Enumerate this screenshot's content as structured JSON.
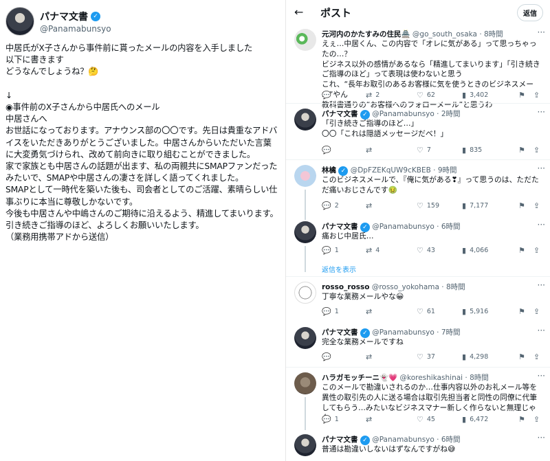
{
  "left": {
    "name": "パナマ文書",
    "handle": "@Panamabunsyo",
    "body": "中居氏がX子さんから事件前に貰ったメールの内容を入手しました\n以下に書きます\nどうなんでしょうね？🤔\n\n↓\n◉事件前のX子さんから中居氏へのメール\n中居さんへ\nお世話になっております。アナウンス部の〇〇です。先日は貴重なアドバイスをいただきありがとうございました。中居さんからいただいた言葉に大変勇気づけられ、改めて前向きに取り組むことができました。\n家で家族とも中居さんの話題が出ます、私の両親共にSMAPファンだったみたいで、SMAPや中居さんの凄さを詳しく語ってくれました。\nSMAPとして一時代を築いた後も、司会者としてのご活躍、素晴らしい仕事ぶりに本当に尊敬しかないです。\n今後も中居さんや中嶋さんのご期待に沿えるよう、精進してまいります。\n引き続きご指導のほど、よろしくお願いいたします。\n（業務用携帯アドから送信）"
  },
  "right": {
    "title": "ポスト",
    "reply_button": "返信",
    "show_replies": "返信を表示",
    "tweets": [
      {
        "name": "元河内のかたすみの住民🏯",
        "handle": "@go_south_osaka · 8時間",
        "text": "えぇ…中居くん、この内容で「オレに気がある」って思っちゃったの…？\nビジネス以外の感情があるなら「精進してまいります」「引き続きご指導のほど」って表現は使わないと思う\nこれ、“長年お取引のあるお客様に気を使うときのビジネスメール”やん\n教科書通りの“お客様へのフォローメール”と思うわ",
        "reply": "",
        "retweet": "2",
        "like": "62",
        "views": "3,402"
      },
      {
        "name": "パナマ文書",
        "handle": "@Panamabunsyo · 2時間",
        "text": "「引き続きご指導のほど…」\n〇〇「これは隠語メッセージだべ！」",
        "reply": "",
        "retweet": "",
        "like": "7",
        "views": "835"
      },
      {
        "name": "林檎",
        "handle": "@DpFZEKqUW9cKBEB · 9時間",
        "text": "このビジネスメールで、『俺に気がある❣』って思うのは、ただただ痛いおじさんです🤢",
        "reply": "2",
        "retweet": "",
        "like": "159",
        "views": "7,177"
      },
      {
        "name": "パナマ文書",
        "handle": "@Panamabunsyo · 6時間",
        "text": "痛おじ中居氏…",
        "reply": "1",
        "retweet": "4",
        "like": "43",
        "views": "4,066"
      },
      {
        "name": "rosso_rosso",
        "handle": "@rosso_yokohama · 8時間",
        "text": "丁寧な業務メールやな😀",
        "reply": "1",
        "retweet": "",
        "like": "61",
        "views": "5,916"
      },
      {
        "name": "パナマ文書",
        "handle": "@Panamabunsyo · 7時間",
        "text": "完全な業務メールですね",
        "reply": "",
        "retweet": "",
        "like": "37",
        "views": "4,298"
      },
      {
        "name": "ハラガモッチーニ👻💗",
        "handle": "@koreshikashinai · 8時間",
        "text": "このメールで勘違いされるのか…仕事内容以外のお礼メール等を異性の取引先の人に送る場合は取引先担当者と同性の同僚に代筆してもらう…みたいなビジネスマナー新しく作らないと無理じゃん",
        "reply": "1",
        "retweet": "",
        "like": "45",
        "views": "6,472"
      },
      {
        "name": "パナマ文書",
        "handle": "@Panamabunsyo · 6時間",
        "text": "普通は勘違いしないはずなんですがね😅",
        "reply": "",
        "retweet": "",
        "like": "",
        "views": ""
      }
    ]
  }
}
